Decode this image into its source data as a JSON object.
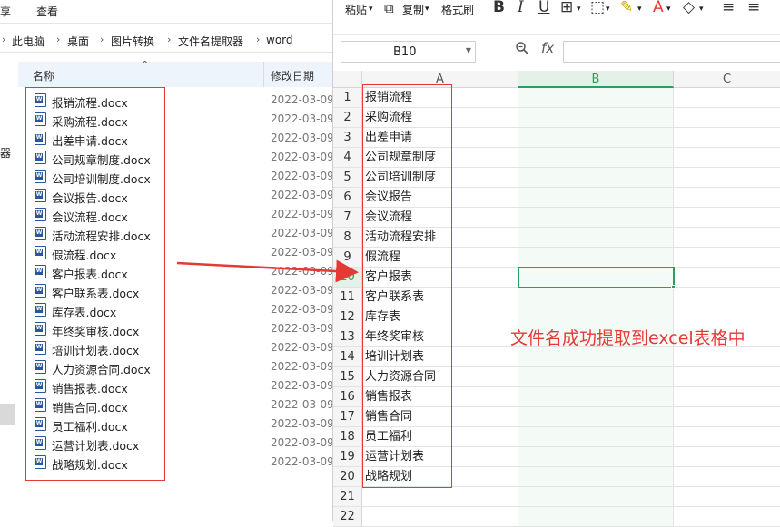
{
  "explorer": {
    "ribbon": {
      "share_label": "享",
      "view_label": "查看"
    },
    "breadcrumb": [
      "此电脑",
      "桌面",
      "图片转换",
      "文件名提取器",
      "word"
    ],
    "columns": {
      "name": "名称",
      "modified": "修改日期"
    },
    "left_nav_fragment": "器",
    "files": [
      {
        "name": "报销流程.docx",
        "date": "2022-03-09"
      },
      {
        "name": "采购流程.docx",
        "date": "2022-03-09"
      },
      {
        "name": "出差申请.docx",
        "date": "2022-03-09"
      },
      {
        "name": "公司规章制度.docx",
        "date": "2022-03-09"
      },
      {
        "name": "公司培训制度.docx",
        "date": "2022-03-09"
      },
      {
        "name": "会议报告.docx",
        "date": "2022-03-09"
      },
      {
        "name": "会议流程.docx",
        "date": "2022-03-09"
      },
      {
        "name": "活动流程安排.docx",
        "date": "2022-03-09"
      },
      {
        "name": "假流程.docx",
        "date": "2022-03-09"
      },
      {
        "name": "客户报表.docx",
        "date": "2022-03-09"
      },
      {
        "name": "客户联系表.docx",
        "date": "2022-03-09"
      },
      {
        "name": "库存表.docx",
        "date": "2022-03-09"
      },
      {
        "name": "年终奖审核.docx",
        "date": "2022-03-09"
      },
      {
        "name": "培训计划表.docx",
        "date": "2022-03-09"
      },
      {
        "name": "人力资源合同.docx",
        "date": "2022-03-09"
      },
      {
        "name": "销售报表.docx",
        "date": "2022-03-09"
      },
      {
        "name": "销售合同.docx",
        "date": "2022-03-09"
      },
      {
        "name": "员工福利.docx",
        "date": "2022-03-09"
      },
      {
        "name": "运营计划表.docx",
        "date": "2022-03-09"
      },
      {
        "name": "战略规划.docx",
        "date": "2022-03-09"
      }
    ]
  },
  "spreadsheet": {
    "toolbar": {
      "paste": "粘贴",
      "copy": "复制",
      "format_painter": "格式刷",
      "bold": "B",
      "italic": "I",
      "underline": "U",
      "font_color": "A"
    },
    "name_box": "B10",
    "fx_label": "fx",
    "columns": [
      "A",
      "B",
      "C"
    ],
    "selected_column": "B",
    "selected_row": 10,
    "rows": [
      {
        "num": "1",
        "a": "报销流程"
      },
      {
        "num": "2",
        "a": "采购流程"
      },
      {
        "num": "3",
        "a": "出差申请"
      },
      {
        "num": "4",
        "a": "公司规章制度"
      },
      {
        "num": "5",
        "a": "公司培训制度"
      },
      {
        "num": "6",
        "a": "会议报告"
      },
      {
        "num": "7",
        "a": "会议流程"
      },
      {
        "num": "8",
        "a": "活动流程安排"
      },
      {
        "num": "9",
        "a": "假流程"
      },
      {
        "num": "10",
        "a": "客户报表"
      },
      {
        "num": "11",
        "a": "客户联系表"
      },
      {
        "num": "12",
        "a": "库存表"
      },
      {
        "num": "13",
        "a": "年终奖审核"
      },
      {
        "num": "14",
        "a": "培训计划表"
      },
      {
        "num": "15",
        "a": "人力资源合同"
      },
      {
        "num": "16",
        "a": "销售报表"
      },
      {
        "num": "17",
        "a": "销售合同"
      },
      {
        "num": "18",
        "a": "员工福利"
      },
      {
        "num": "19",
        "a": "运营计划表"
      },
      {
        "num": "20",
        "a": "战略规划"
      },
      {
        "num": "21",
        "a": ""
      },
      {
        "num": "22",
        "a": ""
      }
    ]
  },
  "annotation": {
    "text": "文件名成功提取到excel表格中",
    "color": "#e53935"
  },
  "colors": {
    "accent_green": "#2f9e5d",
    "highlight_red": "#e53935",
    "word_blue": "#2b579a"
  }
}
